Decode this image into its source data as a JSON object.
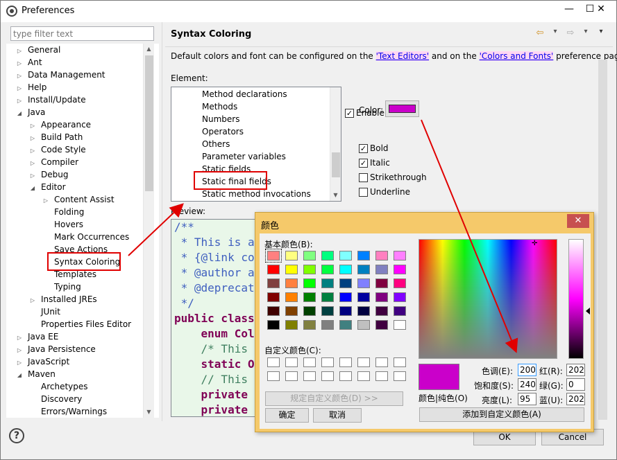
{
  "window": {
    "title": "Preferences",
    "minimize": "—",
    "maximize": "☐",
    "close": "✕"
  },
  "filter": {
    "placeholder": "type filter text"
  },
  "tree": {
    "items": [
      {
        "label": "General",
        "level": 0,
        "arrow": "▷"
      },
      {
        "label": "Ant",
        "level": 0,
        "arrow": "▷"
      },
      {
        "label": "Data Management",
        "level": 0,
        "arrow": "▷"
      },
      {
        "label": "Help",
        "level": 0,
        "arrow": "▷"
      },
      {
        "label": "Install/Update",
        "level": 0,
        "arrow": "▷"
      },
      {
        "label": "Java",
        "level": 0,
        "arrow": "◢"
      },
      {
        "label": "Appearance",
        "level": 1,
        "arrow": "▷"
      },
      {
        "label": "Build Path",
        "level": 1,
        "arrow": "▷"
      },
      {
        "label": "Code Style",
        "level": 1,
        "arrow": "▷"
      },
      {
        "label": "Compiler",
        "level": 1,
        "arrow": "▷"
      },
      {
        "label": "Debug",
        "level": 1,
        "arrow": "▷"
      },
      {
        "label": "Editor",
        "level": 1,
        "arrow": "◢"
      },
      {
        "label": "Content Assist",
        "level": 2,
        "arrow": "▷"
      },
      {
        "label": "Folding",
        "level": 2,
        "arrow": ""
      },
      {
        "label": "Hovers",
        "level": 2,
        "arrow": ""
      },
      {
        "label": "Mark Occurrences",
        "level": 2,
        "arrow": ""
      },
      {
        "label": "Save Actions",
        "level": 2,
        "arrow": ""
      },
      {
        "label": "Syntax Coloring",
        "level": 2,
        "arrow": ""
      },
      {
        "label": "Templates",
        "level": 2,
        "arrow": ""
      },
      {
        "label": "Typing",
        "level": 2,
        "arrow": ""
      },
      {
        "label": "Installed JREs",
        "level": 1,
        "arrow": "▷"
      },
      {
        "label": "JUnit",
        "level": 1,
        "arrow": ""
      },
      {
        "label": "Properties Files Editor",
        "level": 1,
        "arrow": ""
      },
      {
        "label": "Java EE",
        "level": 0,
        "arrow": "▷"
      },
      {
        "label": "Java Persistence",
        "level": 0,
        "arrow": "▷"
      },
      {
        "label": "JavaScript",
        "level": 0,
        "arrow": "▷"
      },
      {
        "label": "Maven",
        "level": 0,
        "arrow": "◢"
      },
      {
        "label": "Archetypes",
        "level": 1,
        "arrow": ""
      },
      {
        "label": "Discovery",
        "level": 1,
        "arrow": ""
      },
      {
        "label": "Errors/Warnings",
        "level": 1,
        "arrow": ""
      }
    ]
  },
  "page": {
    "title": "Syntax Coloring",
    "back": "⇦",
    "forward": "⇨",
    "menu": "▾",
    "desc_pre": "Default colors and font can be configured on the ",
    "link1": "'Text Editors'",
    "desc_mid": " and on the ",
    "link2": "'Colors and Fonts'",
    "desc_post": " preference page.",
    "element_label": "Element:",
    "elements": [
      "Method declarations",
      "Methods",
      "Numbers",
      "Operators",
      "Others",
      "Parameter variables",
      "Static fields",
      "Static final fields",
      "Static method invocations"
    ],
    "enable": "Enable",
    "color_label": "Color:",
    "color_value": "#ca00ca",
    "bold": "Bold",
    "italic": "Italic",
    "strikethrough": "Strikethrough",
    "underline": "Underline",
    "preview_label": "Preview:",
    "code": [
      {
        "text": "/**",
        "color": "#3f5fbf"
      },
      {
        "text": " * This is a",
        "color": "#3f5fbf"
      },
      {
        "text": " * {@link co",
        "color": "#3f5fbf"
      },
      {
        "text": " * @author a",
        "color": "#3f5fbf"
      },
      {
        "text": " * @deprecat",
        "color": "#3f5fbf"
      },
      {
        "text": " */",
        "color": "#3f5fbf"
      },
      {
        "text": "public class",
        "color": "#7f0055"
      },
      {
        "text": "    enum Col",
        "color": "#7f0055"
      },
      {
        "text": "    /* This ",
        "color": "#3f7f5f"
      },
      {
        "text": "    static O",
        "color": "#7f0055"
      },
      {
        "text": "    // This ",
        "color": "#3f7f5f"
      },
      {
        "text": "    private ",
        "color": "#7f0055"
      },
      {
        "text": "    private ",
        "color": "#7f0055"
      }
    ]
  },
  "buttons": {
    "ok": "OK",
    "cancel": "Cancel",
    "help": "?"
  },
  "color_dialog": {
    "title": "颜色",
    "close": "✕",
    "basic_label": "基本颜色(B):",
    "custom_label": "自定义颜色(C):",
    "define_custom": "规定自定义颜色(D) >>",
    "ok": "确定",
    "cancel": "取消",
    "color_solid": "颜色|纯色(O)",
    "hue_label": "色调(E):",
    "sat_label": "饱和度(S):",
    "lum_label": "亮度(L):",
    "red_label": "红(R):",
    "green_label": "绿(G):",
    "blue_label": "蓝(U):",
    "hue": "200",
    "sat": "240",
    "lum": "95",
    "red": "202",
    "green": "0",
    "blue": "202",
    "add_custom": "添加到自定义颜色(A)",
    "basic_colors": [
      "#ff8080",
      "#ffff80",
      "#80ff80",
      "#00ff80",
      "#80ffff",
      "#0080ff",
      "#ff80c0",
      "#ff80ff",
      "#ff0000",
      "#ffff00",
      "#80ff00",
      "#00ff40",
      "#00ffff",
      "#0080c0",
      "#8080c0",
      "#ff00ff",
      "#804040",
      "#ff8040",
      "#00ff00",
      "#008080",
      "#004080",
      "#8080ff",
      "#800040",
      "#ff0080",
      "#800000",
      "#ff8000",
      "#008000",
      "#008040",
      "#0000ff",
      "#0000a0",
      "#800080",
      "#8000ff",
      "#400000",
      "#804000",
      "#004000",
      "#004040",
      "#000080",
      "#000040",
      "#400040",
      "#400080",
      "#000000",
      "#808000",
      "#808040",
      "#808080",
      "#408080",
      "#c0c0c0",
      "#400040",
      "#ffffff"
    ]
  }
}
